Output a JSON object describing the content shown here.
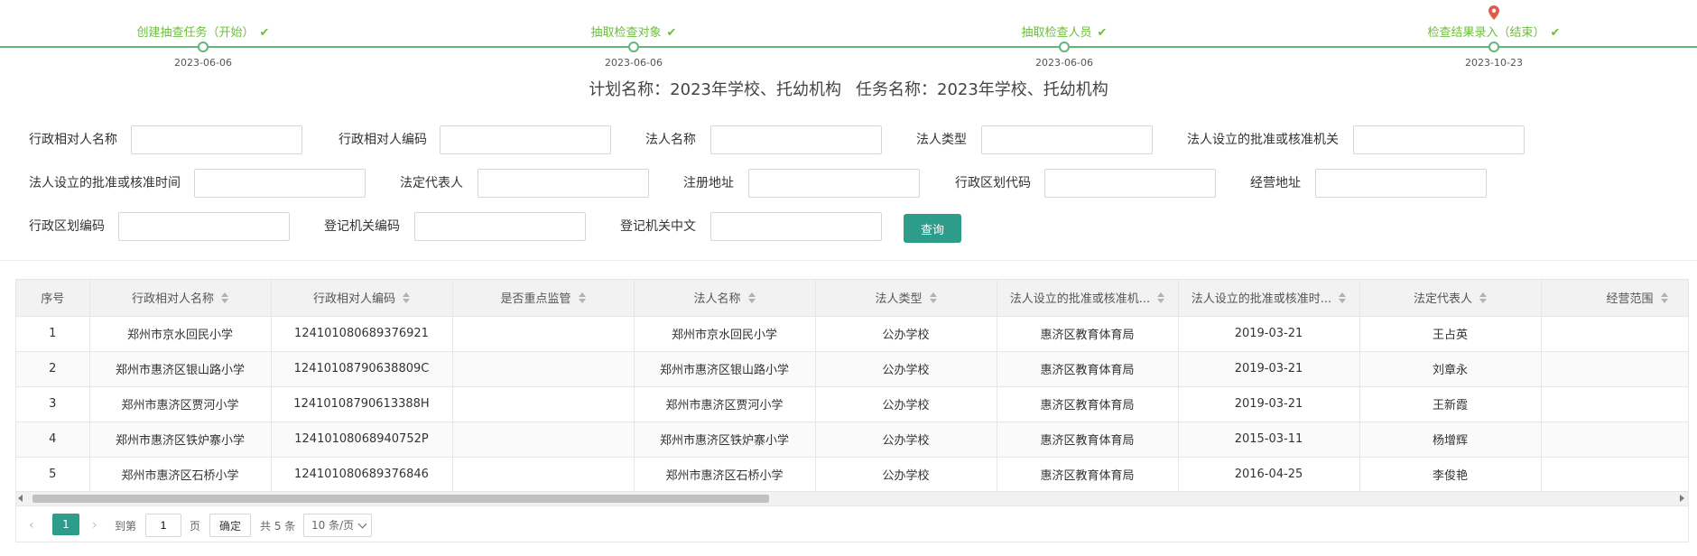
{
  "timeline": {
    "steps": [
      {
        "label": "创建抽查任务（开始）",
        "date": "2023-06-06"
      },
      {
        "label": "抽取检查对象",
        "date": "2023-06-06"
      },
      {
        "label": "抽取检查人员",
        "date": "2023-06-06"
      },
      {
        "label": "检查结果录入（结束）",
        "date": "2023-10-23"
      }
    ],
    "color": "#6cbf3b"
  },
  "plan": {
    "plan_name": "计划名称：2023年学校、托幼机构",
    "task_name": "任务名称：2023年学校、托幼机构"
  },
  "filters": {
    "admin_name": "行政相对人名称",
    "admin_code": "行政相对人编码",
    "legal_name": "法人名称",
    "legal_type": "法人类型",
    "approval_org": "法人设立的批准或核准机关",
    "approval_time": "法人设立的批准或核准时间",
    "legal_rep": "法定代表人",
    "reg_address": "注册地址",
    "region_code": "行政区划代码",
    "biz_address": "经营地址",
    "region_code2": "行政区划编码",
    "reg_org_code": "登记机关编码",
    "reg_org_cn": "登记机关中文",
    "query_button": "查询"
  },
  "table": {
    "headers": [
      "序号",
      "行政相对人名称",
      "行政相对人编码",
      "是否重点监管",
      "法人名称",
      "法人类型",
      "法人设立的批准或核准机...",
      "法人设立的批准或核准时...",
      "法定代表人",
      "经营范围"
    ],
    "rows": [
      [
        "1",
        "郑州市京水回民小学",
        "124101080689376921",
        "",
        "郑州市京水回民小学",
        "公办学校",
        "惠济区教育体育局",
        "2019-03-21",
        "王占英",
        ""
      ],
      [
        "2",
        "郑州市惠济区银山路小学",
        "12410108790638809C",
        "",
        "郑州市惠济区银山路小学",
        "公办学校",
        "惠济区教育体育局",
        "2019-03-21",
        "刘章永",
        ""
      ],
      [
        "3",
        "郑州市惠济区贾河小学",
        "12410108790613388H",
        "",
        "郑州市惠济区贾河小学",
        "公办学校",
        "惠济区教育体育局",
        "2019-03-21",
        "王新霞",
        ""
      ],
      [
        "4",
        "郑州市惠济区铁炉寨小学",
        "12410108068940752P",
        "",
        "郑州市惠济区铁炉寨小学",
        "公办学校",
        "惠济区教育体育局",
        "2015-03-11",
        "杨增辉",
        ""
      ],
      [
        "5",
        "郑州市惠济区石桥小学",
        "124101080689376846",
        "",
        "郑州市惠济区石桥小学",
        "公办学校",
        "惠济区教育体育局",
        "2016-04-25",
        "李俊艳",
        ""
      ]
    ]
  },
  "pager": {
    "prev": "‹",
    "next": "›",
    "current": "1",
    "goto": "到第",
    "page_value": "1",
    "page_unit": "页",
    "ok": "确定",
    "total": "共 5 条",
    "page_size": "10 条/页"
  },
  "colors": {
    "accent": "#2e9c8a",
    "timeline": "#5fb878",
    "pin": "#e15b4b"
  }
}
